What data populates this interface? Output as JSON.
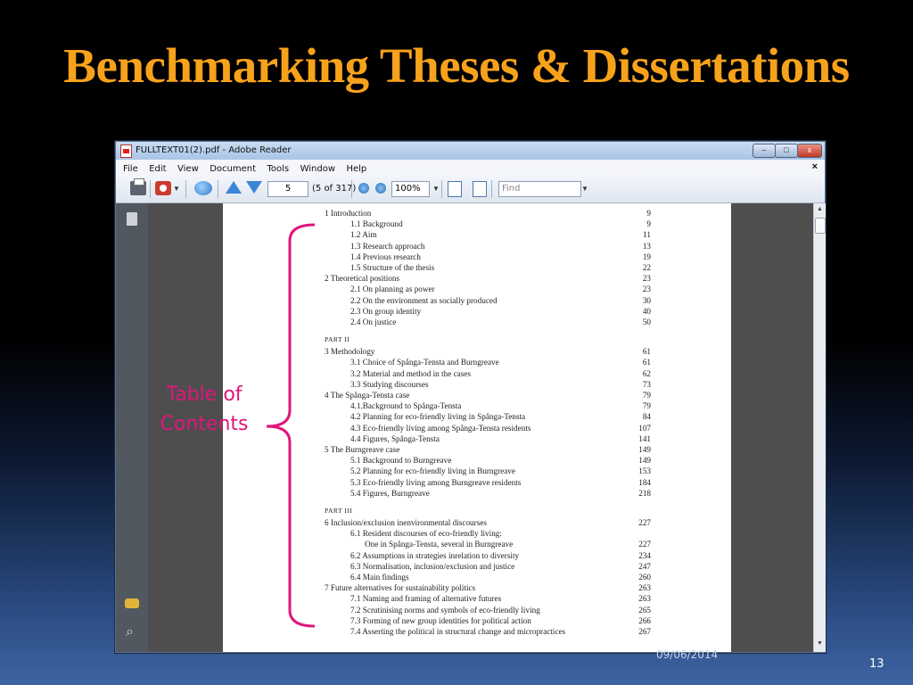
{
  "slide": {
    "title": "Benchmarking Theses & Dissertations",
    "annotation": {
      "line1": "Table of",
      "line2": "Contents"
    },
    "date": "09/06/2014",
    "slide_number": "13"
  },
  "window": {
    "title": "FULLTEXT01(2).pdf - Adobe Reader",
    "buttons": {
      "minimize": "–",
      "maximize": "□",
      "close": "x"
    }
  },
  "menubar": {
    "items": [
      "File",
      "Edit",
      "View",
      "Document",
      "Tools",
      "Window",
      "Help"
    ],
    "close_doc": "×"
  },
  "toolbar": {
    "page_value": "5",
    "page_count": "(5 of 317)",
    "zoom_value": "100%",
    "find_placeholder": "Find",
    "icons": [
      "print-icon",
      "share-icon",
      "comment-icon",
      "prev-page-icon",
      "next-page-icon",
      "zoom-out-icon",
      "zoom-in-icon",
      "fit-page-icon",
      "full-screen-icon"
    ]
  },
  "nav_pane": {
    "icons": [
      "pages-icon",
      "comments-icon",
      "attachments-icon"
    ]
  },
  "toc": [
    {
      "text": "1 Introduction",
      "page": "9",
      "indent": 0
    },
    {
      "text": "1.1 Background",
      "page": "9",
      "indent": 1
    },
    {
      "text": "1.2 Aim",
      "page": "11",
      "indent": 1
    },
    {
      "text": "1.3 Research approach",
      "page": "13",
      "indent": 1
    },
    {
      "text": "1.4 Previous research",
      "page": "19",
      "indent": 1
    },
    {
      "text": "1.5 Structure of the thesis",
      "page": "22",
      "indent": 1
    },
    {
      "text": "2 Theoretical positions",
      "page": "23",
      "indent": 0
    },
    {
      "text": "2.1 On planning as power",
      "page": "23",
      "indent": 1
    },
    {
      "text": "2.2 On the environment as socially produced",
      "page": "30",
      "indent": 1
    },
    {
      "text": "2.3 On group identity",
      "page": "40",
      "indent": 1
    },
    {
      "text": "2.4 On justice",
      "page": "50",
      "indent": 1
    },
    {
      "part": "PART II"
    },
    {
      "text": "3 Methodology",
      "page": "61",
      "indent": 0
    },
    {
      "text": "3.1 Choice of Spånga-Tensta and Burngreave",
      "page": "61",
      "indent": 1
    },
    {
      "text": "3.2 Material and method in the cases",
      "page": "62",
      "indent": 1
    },
    {
      "text": "3.3 Studying discourses",
      "page": "73",
      "indent": 1
    },
    {
      "text": "4 The Spånga-Tensta case",
      "page": "79",
      "indent": 0
    },
    {
      "text": "4.1.Background to Spånga-Tensta",
      "page": "79",
      "indent": 1
    },
    {
      "text": "4.2 Planning for eco-friendly living in Spånga-Tensta",
      "page": "84",
      "indent": 1
    },
    {
      "text": "4.3 Eco-friendly living among Spånga-Tensta residents",
      "page": "107",
      "indent": 1
    },
    {
      "text": "4.4 Figures, Spånga-Tensta",
      "page": "141",
      "indent": 1
    },
    {
      "text": "5 The Burngreave case",
      "page": "149",
      "indent": 0
    },
    {
      "text": "5.1 Background to Burngreave",
      "page": "149",
      "indent": 1
    },
    {
      "text": "5.2 Planning for eco-friendly living in Burngreave",
      "page": "153",
      "indent": 1
    },
    {
      "text": "5.3 Eco-friendly living among Burngreave residents",
      "page": "184",
      "indent": 1
    },
    {
      "text": "5.4 Figures, Burngreave",
      "page": "218",
      "indent": 1
    },
    {
      "part": "PART III"
    },
    {
      "text": "6 Inclusion/exclusion inenvironmental discourses",
      "page": "227",
      "indent": 0
    },
    {
      "text": "6.1 Resident discourses of eco-friendly living:",
      "page": "",
      "indent": 1
    },
    {
      "text": "One in Spånga-Tensta, several in Burngreave",
      "page": "227",
      "indent": 2
    },
    {
      "text": "6.2 Assumptions in strategies inrelation to diversity",
      "page": "234",
      "indent": 1
    },
    {
      "text": "6.3 Normalisation, inclusion/exclusion and justice",
      "page": "247",
      "indent": 1
    },
    {
      "text": "6.4 Main findings",
      "page": "260",
      "indent": 1
    },
    {
      "text": "7 Future alternatives for sustainability politics",
      "page": "263",
      "indent": 0
    },
    {
      "text": "7.1 Naming and framing of alternative futures",
      "page": "263",
      "indent": 1
    },
    {
      "text": "7.2 Scrutinising norms and symbols of eco-friendly living",
      "page": "265",
      "indent": 1
    },
    {
      "text": "7.3 Forming of new group identities for political action",
      "page": "266",
      "indent": 1
    },
    {
      "text": "7.4 Asserting the political in structural change and micropractices",
      "page": "267",
      "indent": 1
    }
  ]
}
